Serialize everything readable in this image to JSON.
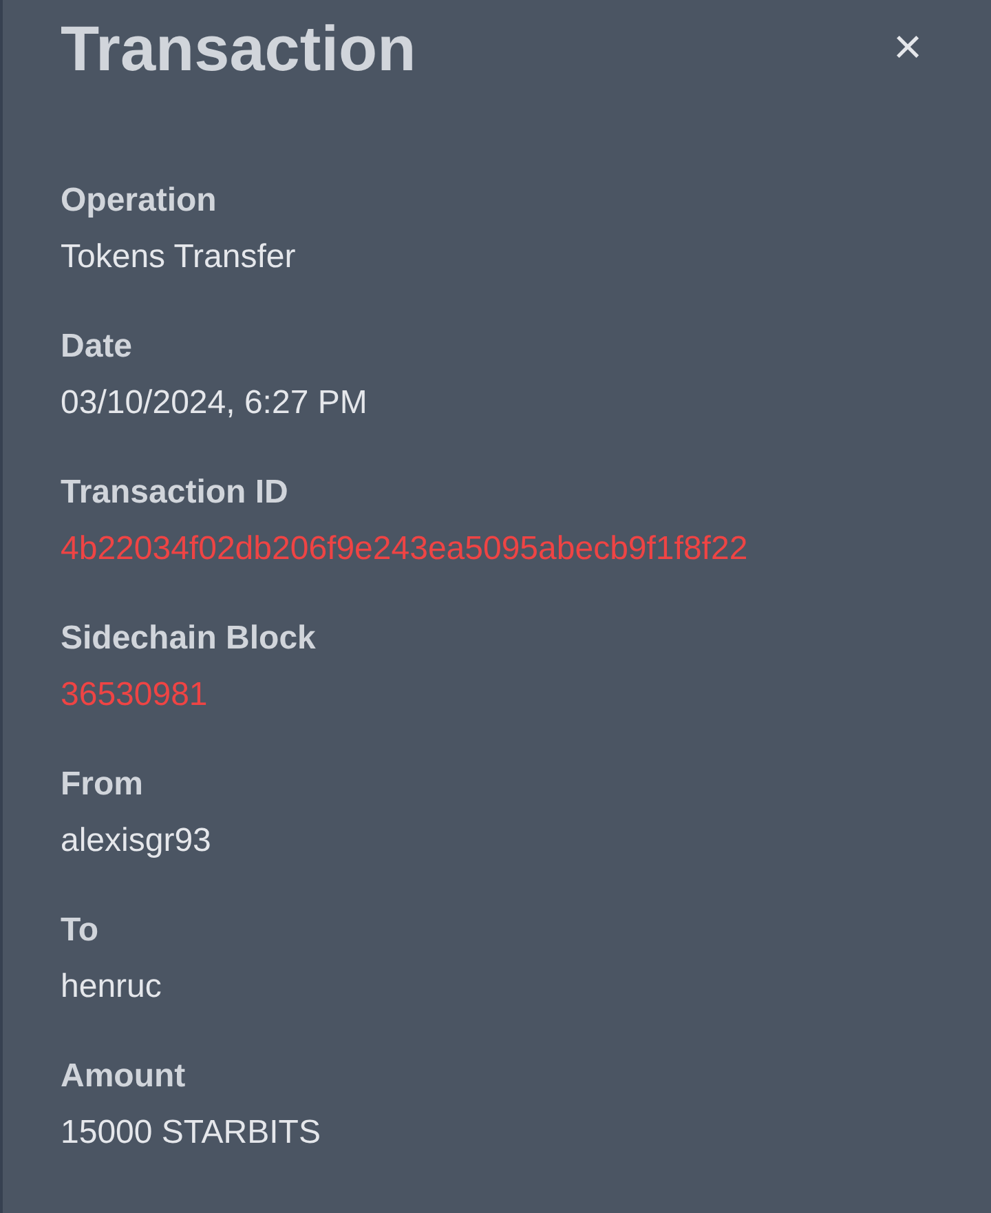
{
  "panel": {
    "title": "Transaction",
    "close": "×"
  },
  "fields": [
    {
      "label": "Operation",
      "value": "Tokens Transfer",
      "kind": "text"
    },
    {
      "label": "Date",
      "value": "03/10/2024, 6:27 PM",
      "kind": "text"
    },
    {
      "label": "Transaction ID",
      "value": "4b22034f02db206f9e243ea5095abecb9f1f8f22",
      "kind": "link"
    },
    {
      "label": "Sidechain Block",
      "value": "36530981",
      "kind": "link"
    },
    {
      "label": "From",
      "value": "alexisgr93",
      "kind": "text"
    },
    {
      "label": "To",
      "value": "henruc",
      "kind": "text"
    },
    {
      "label": "Amount",
      "value": "15000 STARBITS",
      "kind": "text"
    }
  ]
}
